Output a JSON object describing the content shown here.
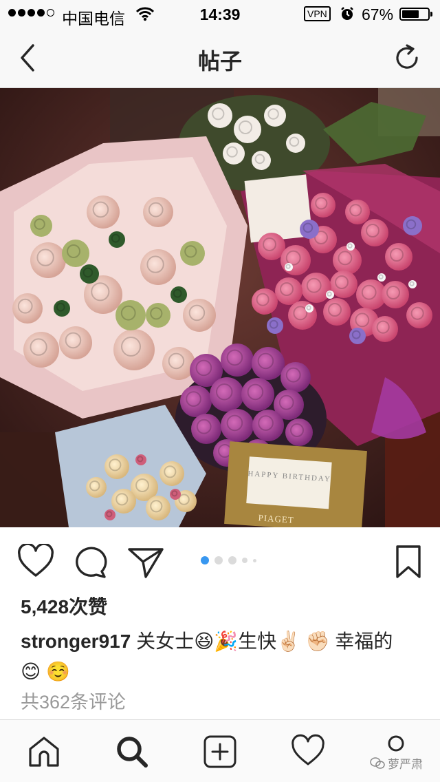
{
  "status_bar": {
    "carrier": "中国电信",
    "time": "14:39",
    "vpn": "VPN",
    "battery": "67%",
    "battery_level": 0.67,
    "signal_bars_filled": 4,
    "signal_bars_total": 5
  },
  "nav": {
    "title": "帖子",
    "back_icon": "chevron-left-icon",
    "refresh_icon": "refresh-icon"
  },
  "post": {
    "photo_card_text": "HAPPY BIRTHDAY",
    "photo_brand_text": "PIAGET",
    "carousel": {
      "count": 5,
      "active_index": 0
    },
    "likes": "5,428次赞",
    "caption_username": "stronger917",
    "caption_text": " 关女士😆🎉生快✌🏻 ✊🏻 幸福的😊 ☺️",
    "comments_link": "共362条评论"
  },
  "actions": [
    "heart-icon",
    "comment-icon",
    "send-icon",
    "bookmark-icon"
  ],
  "tab_bar": [
    "home-icon",
    "search-icon",
    "add-post-icon",
    "activity-heart-icon",
    "profile-icon"
  ],
  "watermark": "萝严肃",
  "colors": {
    "accent_blue": "#3897f0",
    "text_dark": "#262626",
    "text_muted": "#999999",
    "border": "#dbdbdb",
    "bar_bg": "#f8f8f8"
  }
}
